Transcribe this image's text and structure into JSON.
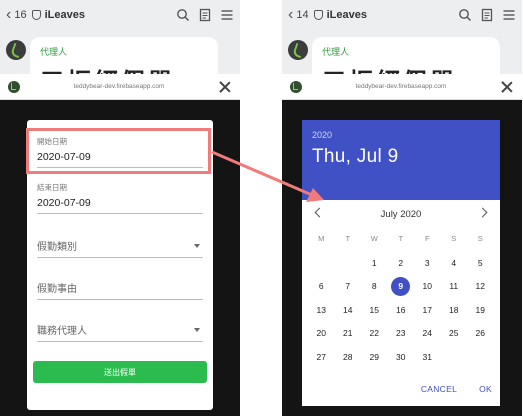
{
  "left_phone": {
    "topbar": {
      "count": "16",
      "title": "iLeaves"
    },
    "bubble": {
      "agent": "代理人",
      "big_text": "三振經假單"
    },
    "url": "teddybear-dev.firebaseapp.com",
    "form": {
      "start_label": "開始日期",
      "start_value": "2020-07-09",
      "end_label": "結束日期",
      "end_value": "2020-07-09",
      "leave_type": "假勤類別",
      "reason": "假勤事由",
      "deputy": "職務代理人",
      "submit": "送出假單"
    }
  },
  "right_phone": {
    "topbar": {
      "count": "14",
      "title": "iLeaves"
    },
    "bubble": {
      "agent": "代理人",
      "big_text": "三振經假單"
    },
    "url": "teddybear-dev.firebaseapp.com",
    "picker": {
      "year": "2020",
      "date": "Thu, Jul 9",
      "month": "July 2020",
      "weekdays": [
        "M",
        "T",
        "W",
        "T",
        "F",
        "S",
        "S"
      ],
      "leading_blanks": 2,
      "days_in_month": 31,
      "selected_day": 9,
      "cancel": "CANCEL",
      "ok": "OK"
    }
  },
  "colors": {
    "accent": "#3f51c4",
    "submit": "#2cbb4f",
    "highlight": "#f07b7b",
    "agent_text": "#2e9e40"
  }
}
